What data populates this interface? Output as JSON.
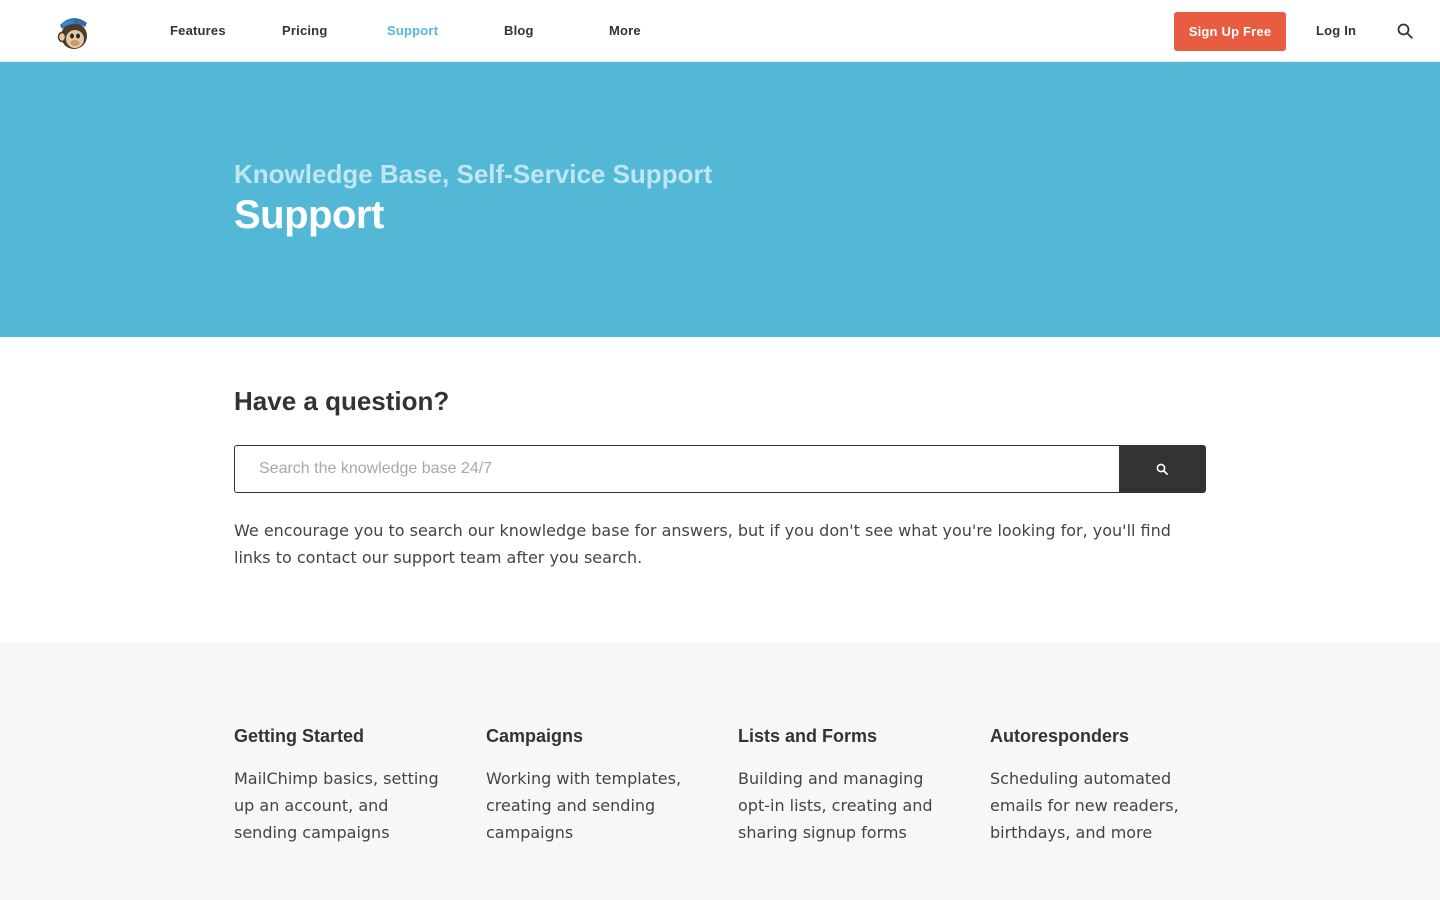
{
  "nav": {
    "items": [
      {
        "label": "Features",
        "active": false
      },
      {
        "label": "Pricing",
        "active": false
      },
      {
        "label": "Support",
        "active": true
      },
      {
        "label": "Blog",
        "active": false
      },
      {
        "label": "More",
        "active": false
      }
    ],
    "signup_label": "Sign Up Free",
    "login_label": "Log In"
  },
  "hero": {
    "subtitle": "Knowledge Base, Self-Service Support",
    "title": "Support"
  },
  "question": {
    "heading": "Have a question?",
    "search_placeholder": "Search the knowledge base 24/7",
    "intro": "We encourage you to search our knowledge base for answers, but if you don't see what you're looking for, you'll find links to contact our support team after you search."
  },
  "categories": [
    {
      "title": "Getting Started",
      "description": "MailChimp basics, setting up an account, and sending campaigns"
    },
    {
      "title": "Campaigns",
      "description": "Working with templates, creating and sending campaigns"
    },
    {
      "title": "Lists and Forms",
      "description": "Building and managing opt-in lists, creating and sharing signup forms"
    },
    {
      "title": "Autoresponders",
      "description": "Scheduling automated emails for new readers, birthdays, and more"
    }
  ],
  "colors": {
    "accent": "#52b8d6",
    "signup": "#e85c41",
    "dark": "#333333"
  }
}
